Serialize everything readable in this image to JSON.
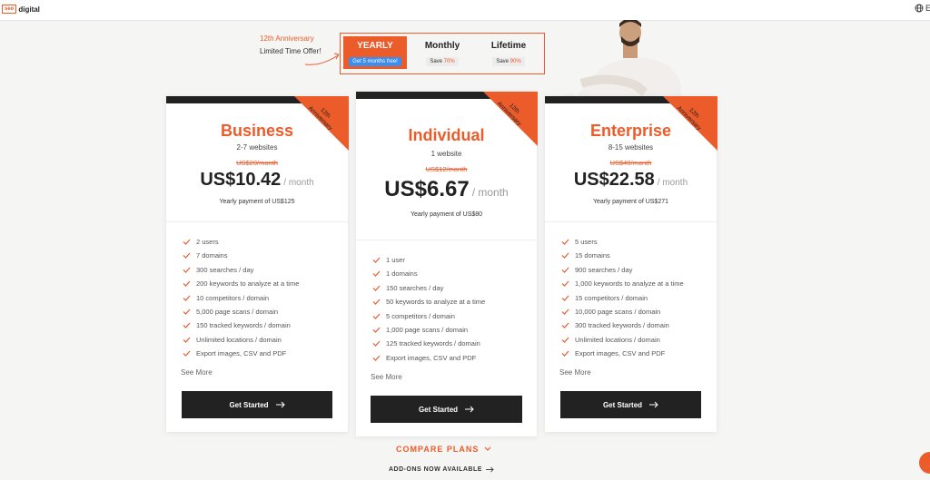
{
  "header": {
    "logo_mark": "seo",
    "logo_text": "digital",
    "lang": "E"
  },
  "offer": {
    "line1": "12th Anniversary",
    "line2": "Limited Time Offer!"
  },
  "billing": [
    {
      "label": "YEARLY",
      "badge_pre": "Get 5 months free!",
      "badge_pct": "",
      "active": true
    },
    {
      "label": "Monthly",
      "badge_pre": "Save ",
      "badge_pct": "70%",
      "active": false
    },
    {
      "label": "Lifetime",
      "badge_pre": "Save ",
      "badge_pct": "90%",
      "active": false
    }
  ],
  "ribbon": {
    "l1": "12th",
    "l2": "Anniversary"
  },
  "plans": {
    "business": {
      "name": "Business",
      "sites": "2-7 websites",
      "old": "US$20/month",
      "price": "US$10.42",
      "per": "/ month",
      "yearly": "Yearly payment of US$125",
      "features": [
        "2 users",
        "7 domains",
        "300 searches / day",
        "200 keywords to analyze at a time",
        "10 competitors / domain",
        "5,000 page scans / domain",
        "150 tracked keywords / domain",
        "Unlimited locations / domain",
        "Export images, CSV and PDF"
      ],
      "see_more": "See More",
      "cta": "Get Started"
    },
    "individual": {
      "name": "Individual",
      "sites": "1 website",
      "old": "US$12/month",
      "price": "US$6.67",
      "per": "/ month",
      "yearly": "Yearly payment of US$80",
      "features": [
        "1 user",
        "1 domains",
        "150 searches / day",
        "50 keywords to analyze at a time",
        "5 competitors / domain",
        "1,000 page scans / domain",
        "125 tracked keywords / domain",
        "Export images, CSV and PDF"
      ],
      "see_more": "See More",
      "cta": "Get Started"
    },
    "enterprise": {
      "name": "Enterprise",
      "sites": "8-15 websites",
      "old": "US$40/month",
      "price": "US$22.58",
      "per": "/ month",
      "yearly": "Yearly payment of US$271",
      "features": [
        "5 users",
        "15 domains",
        "900 searches / day",
        "1,000 keywords to analyze at a time",
        "15 competitors / domain",
        "10,000 page scans / domain",
        "300 tracked keywords / domain",
        "Unlimited locations / domain",
        "Export images, CSV and PDF"
      ],
      "see_more": "See More",
      "cta": "Get Started"
    }
  },
  "footer": {
    "compare": "COMPARE PLANS",
    "addons": "ADD-ONS NOW AVAILABLE"
  },
  "colors": {
    "accent": "#ec5b2a",
    "dark": "#222222",
    "blue": "#3b8df0"
  }
}
